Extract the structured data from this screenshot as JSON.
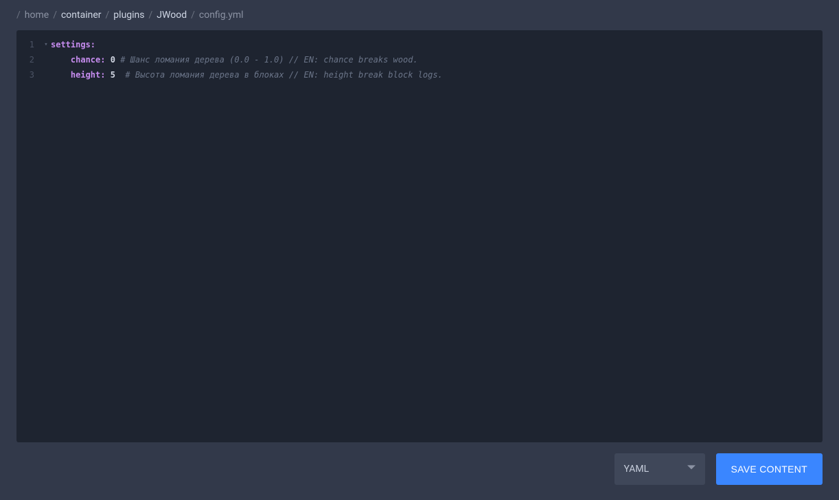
{
  "breadcrumb": {
    "sep": "/",
    "items": [
      {
        "label": "home",
        "muted": true
      },
      {
        "label": "container"
      },
      {
        "label": "plugins"
      },
      {
        "label": "JWood"
      },
      {
        "label": "config.yml",
        "current": true
      }
    ]
  },
  "editor": {
    "lines": [
      {
        "num": "1",
        "fold": "▾",
        "tokens": [
          {
            "cls": "key",
            "text": "settings"
          },
          {
            "cls": "colon",
            "text": ":"
          }
        ]
      },
      {
        "num": "2",
        "tokens": [
          {
            "cls": "plain",
            "text": "    "
          },
          {
            "cls": "mapkey",
            "text": "chance"
          },
          {
            "cls": "colon",
            "text": ": "
          },
          {
            "cls": "val",
            "text": "0"
          },
          {
            "cls": "plain",
            "text": " "
          },
          {
            "cls": "comment",
            "text": "# Шанс ломания дерева (0.0 - 1.0) // EN: chance breaks wood."
          }
        ]
      },
      {
        "num": "3",
        "tokens": [
          {
            "cls": "plain",
            "text": "    "
          },
          {
            "cls": "mapkey",
            "text": "height"
          },
          {
            "cls": "colon",
            "text": ": "
          },
          {
            "cls": "val",
            "text": "5"
          },
          {
            "cls": "plain",
            "text": "  "
          },
          {
            "cls": "comment",
            "text": "# Высота ломания дерева в блоках // EN: height break block logs."
          }
        ]
      }
    ]
  },
  "footer": {
    "language": "YAML",
    "save": "SAVE CONTENT"
  }
}
